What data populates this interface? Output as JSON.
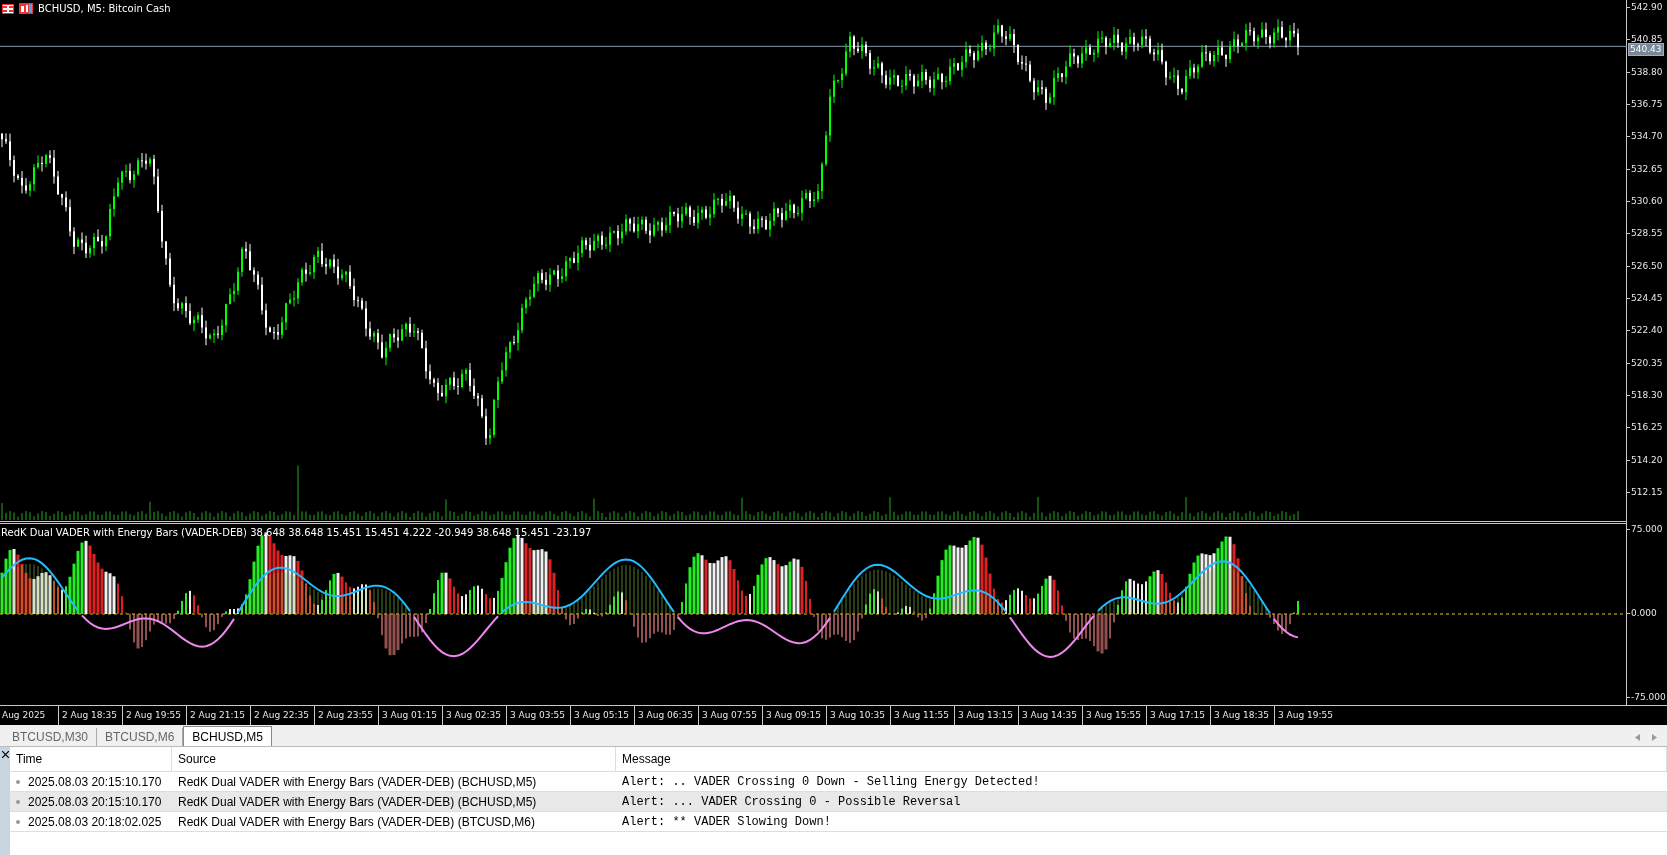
{
  "chart": {
    "title": "BCHUSD, M5:  Bitcoin Cash",
    "price_labels": [
      "542.90",
      "540.85",
      "538.80",
      "536.75",
      "534.70",
      "532.65",
      "530.60",
      "528.55",
      "526.50",
      "524.45",
      "522.40",
      "520.35",
      "518.30",
      "516.25",
      "514.20",
      "512.15"
    ],
    "current_price": "540.43",
    "indicator": {
      "label": "RedK Dual VADER with Energy Bars (VADER-DEB) 38.648 38.648 15.451 15.451 4.222 -20.949 38.648 15.451 -23.197",
      "scale_labels": [
        "75.000",
        "0.000",
        "-75.000"
      ]
    },
    "time_labels": [
      "Aug 2025",
      "2 Aug 18:35",
      "2 Aug 19:55",
      "2 Aug 21:15",
      "2 Aug 22:35",
      "2 Aug 23:55",
      "3 Aug 01:15",
      "3 Aug 02:35",
      "3 Aug 03:55",
      "3 Aug 05:15",
      "3 Aug 06:35",
      "3 Aug 07:55",
      "3 Aug 09:15",
      "3 Aug 10:35",
      "3 Aug 11:55",
      "3 Aug 13:15",
      "3 Aug 14:35",
      "3 Aug 15:55",
      "3 Aug 17:15",
      "3 Aug 18:35",
      "3 Aug 19:55"
    ]
  },
  "tabs": [
    {
      "label": "BTCUSD,M30",
      "selected": false
    },
    {
      "label": "BTCUSD,M6",
      "selected": false
    },
    {
      "label": "BCHUSD,M5",
      "selected": true
    }
  ],
  "alerts": {
    "columns": [
      "Time",
      "Source",
      "Message"
    ],
    "rows": [
      {
        "time": "2025.08.03 20:15:10.170",
        "source": "RedK Dual VADER with Energy Bars (VADER-DEB) (BCHUSD,M5)",
        "message": "Alert: .. VADER Crossing 0 Down - Selling Energy Detected!",
        "selected": false
      },
      {
        "time": "2025.08.03 20:15:10.170",
        "source": "RedK Dual VADER with Energy Bars (VADER-DEB) (BCHUSD,M5)",
        "message": "Alert: ... VADER Crossing 0 - Possible Reversal",
        "selected": true
      },
      {
        "time": "2025.08.03 20:18:02.025",
        "source": "RedK Dual VADER with Energy Bars (VADER-DEB) (BTCUSD,M6)",
        "message": "Alert: ** VADER Slowing Down!",
        "selected": false
      }
    ]
  }
}
